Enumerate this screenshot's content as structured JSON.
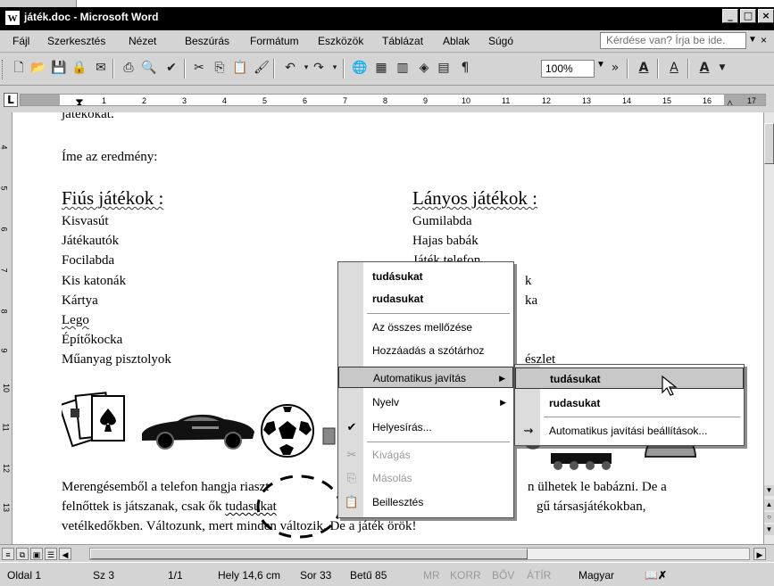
{
  "window": {
    "title": "játék.doc - Microsoft Word",
    "icon": "word-icon",
    "controls": [
      "minimize",
      "restore",
      "close"
    ]
  },
  "menubar": {
    "items": [
      "Fájl",
      "Szerkesztés",
      "Nézet",
      "Beszúrás",
      "Formátum",
      "Eszközök",
      "Táblázat",
      "Ablak",
      "Súgó"
    ],
    "help_box": "Kérdése van? Írja be ide.",
    "close_doc": "×"
  },
  "toolbar": {
    "zoom": "100%",
    "buttons": [
      "new-icon",
      "open-icon",
      "save-icon",
      "permission-icon",
      "email-icon",
      "print-icon",
      "print-preview-icon",
      "spelling-icon",
      "cut-icon",
      "copy-icon",
      "paste-icon",
      "format-painter-icon",
      "undo-icon",
      "redo-icon",
      "hyperlink-icon",
      "table-icon",
      "columns-icon",
      "drawing-icon",
      "show-formatting-icon",
      "zoom-box",
      "highlight-icon",
      "underline-icon",
      "font-color-icon"
    ],
    "highlight_label": "A",
    "underline_label": "A",
    "font_color_label": "A"
  },
  "ruler": {
    "numbers": [
      "1",
      "2",
      "3",
      "4",
      "5",
      "6",
      "7",
      "8",
      "9",
      "10",
      "11",
      "12",
      "13",
      "14",
      "15",
      "16",
      "17"
    ],
    "tab_selector": "L"
  },
  "vertical_ruler": {
    "numbers": [
      "4",
      "5",
      "6",
      "7",
      "8",
      "9",
      "10",
      "11",
      "12",
      "13"
    ]
  },
  "document": {
    "partial_top": "játékokat.",
    "intro": "Íme az eredmény:",
    "boys_heading": "Fiús játékok :",
    "boys_items": [
      "Kisvasút",
      "Játékautók",
      "Focilabda",
      "Kis katonák",
      "Kártya",
      "Lego",
      "Építőkocka",
      "Műanyag pisztolyok"
    ],
    "girls_heading": "Lányos játékok :",
    "girls_items": [
      "Gumilabda",
      "Hajas babák",
      "Játék telefon",
      "…k",
      "…ka",
      "",
      "",
      "…észlet"
    ],
    "girls_partial": {
      "item3": "Játék telefon",
      "item4_tail": "k",
      "item5_tail": "ka",
      "item8_tail": "észlet"
    },
    "paragraph_line1_left": "Merengésemből a telefon hangja riaszt",
    "paragraph_line1_right": "n ülhetek le babázni. De a",
    "paragraph_line2_left": "felnőttek is játszanak, csak ők",
    "paragraph_line2_misspelled": "tudasukat",
    "paragraph_line2_right": "gű társasjátékokban,",
    "paragraph_line3": "vetélkedőkben. Változunk, mert minden változik. De a játék örök!"
  },
  "context_menu": {
    "suggestions": [
      "tudásukat",
      "rudasukat"
    ],
    "ignore_all": "Az összes mellőzése",
    "add_to_dictionary": "Hozzáadás a szótárhoz",
    "autocorrect": "Automatikus javítás",
    "language": "Nyelv",
    "spelling": "Helyesírás...",
    "cut": "Kivágás",
    "copy": "Másolás",
    "paste": "Beillesztés"
  },
  "submenu": {
    "suggestions": [
      "tudásukat",
      "rudasukat"
    ],
    "autocorrect_options": "Automatikus javítási beállítások..."
  },
  "statusbar": {
    "page": "Oldal 1",
    "section": "Sz 3",
    "pages": "1/1",
    "position": "Hely 14,6 cm",
    "line": "Sor 33",
    "column": "Betű 85",
    "rec": "MR",
    "trk": "KORR",
    "ext": "BŐV",
    "ovr": "ÁTÍR",
    "language": "Magyar"
  },
  "colors": {
    "titlebar": "#000000",
    "chrome": "#d4d4d4",
    "menu_highlight": "#c8c8c8"
  }
}
